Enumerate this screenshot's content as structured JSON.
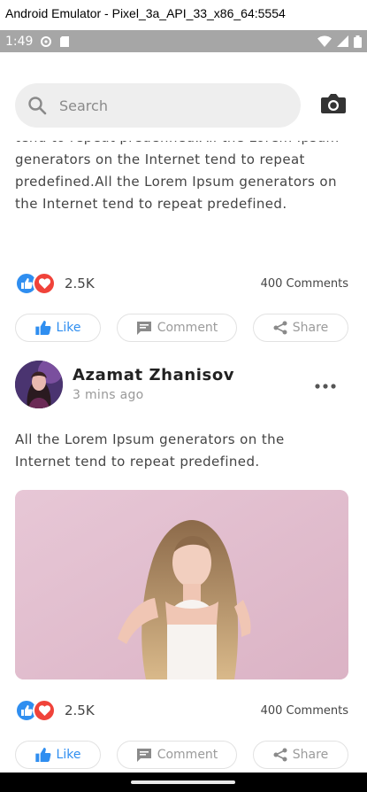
{
  "window": {
    "title": "Android Emulator - Pixel_3a_API_33_x86_64:5554"
  },
  "status_bar": {
    "time": "1:49"
  },
  "search": {
    "placeholder": "Search"
  },
  "post1": {
    "text": "tend to repeat predefined.All the Lorem Ipsum generators on the Internet tend to repeat predefined.All the Lorem Ipsum generators on the Internet tend to repeat predefined.",
    "reaction_count": "2.5K",
    "comments_count": "400 Comments",
    "like_label": "Like",
    "comment_label": "Comment",
    "share_label": "Share"
  },
  "post2": {
    "author": "Azamat Zhanisov",
    "time": "3 mins ago",
    "text": "All the Lorem Ipsum generators on the Internet tend to repeat predefined.",
    "reaction_count": "2.5K",
    "comments_count": "400 Comments",
    "like_label": "Like",
    "comment_label": "Comment",
    "share_label": "Share"
  },
  "colors": {
    "accent": "#2f8ef0",
    "love": "#f0433a",
    "search_bg": "#eeeeee",
    "status_bar": "#a6a6a6"
  },
  "icons": [
    "search-icon",
    "camera-icon",
    "like-icon",
    "heart-icon",
    "thumbs-up-icon",
    "comment-icon",
    "share-icon",
    "more-icon"
  ]
}
